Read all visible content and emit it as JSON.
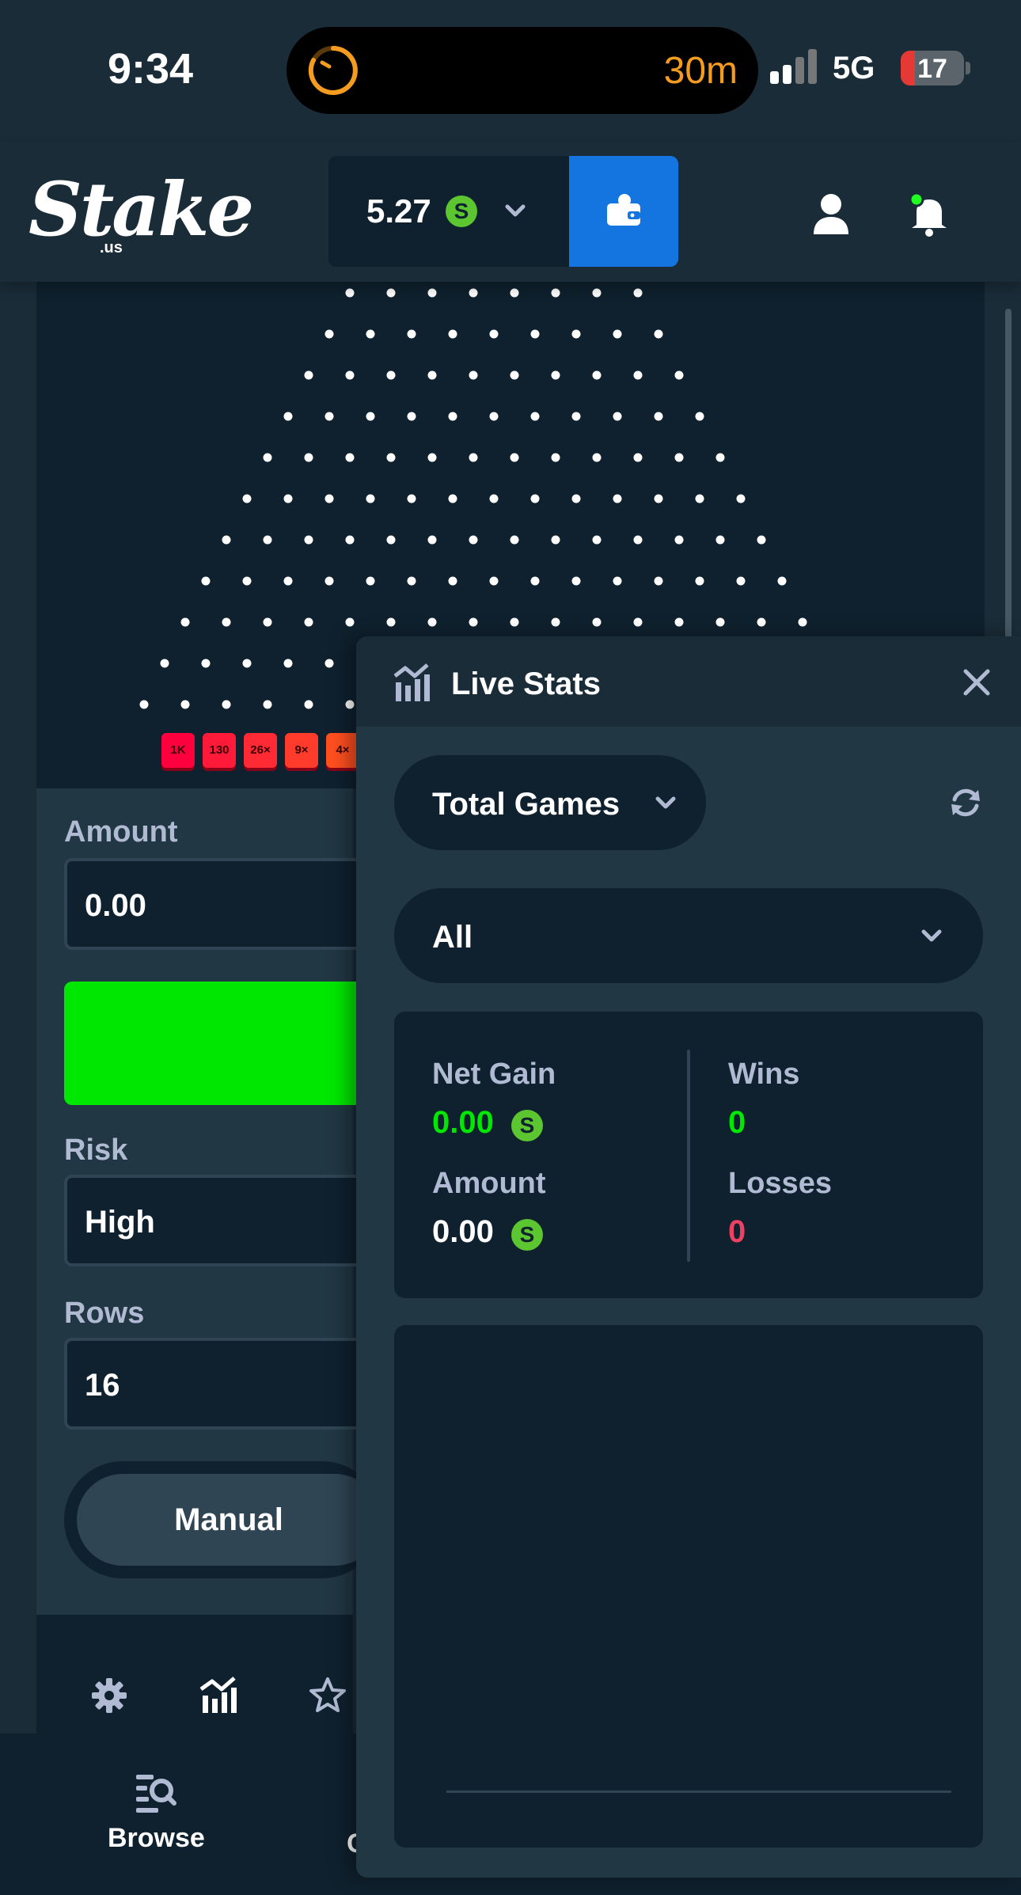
{
  "status_bar": {
    "time": "9:34",
    "timer_text": "30m",
    "network": "5G",
    "battery": "17"
  },
  "header": {
    "logo_text": "Stake",
    "logo_sub": ".us",
    "balance": "5.27",
    "currency_symbol": "S"
  },
  "game": {
    "multipliers": [
      "1K",
      "130",
      "26×",
      "9×",
      "4×"
    ],
    "colors": {
      "board": "#0f212e",
      "peg": "#ffffff",
      "mult_red": "#ff003f",
      "mult_orange": "#ff4f1f"
    }
  },
  "controls": {
    "amount_label": "Amount",
    "amount_value": "0.00",
    "risk_label": "Risk",
    "risk_value": "High",
    "rows_label": "Rows",
    "rows_value": "16",
    "mode_tab": "Manual",
    "bet_button_color": "#00e701"
  },
  "live_stats": {
    "title": "Live Stats",
    "period_select": "Total Games",
    "game_filter": "All",
    "net_gain_label": "Net Gain",
    "net_gain_value": "0.00",
    "amount_label": "Amount",
    "amount_value": "0.00",
    "wins_label": "Wins",
    "wins_value": "0",
    "losses_label": "Losses",
    "losses_value": "0",
    "colors": {
      "positive": "#00e701",
      "negative": "#ed4163"
    }
  },
  "bottom_nav": {
    "browse_label": "Browse",
    "partial_label": "C"
  }
}
